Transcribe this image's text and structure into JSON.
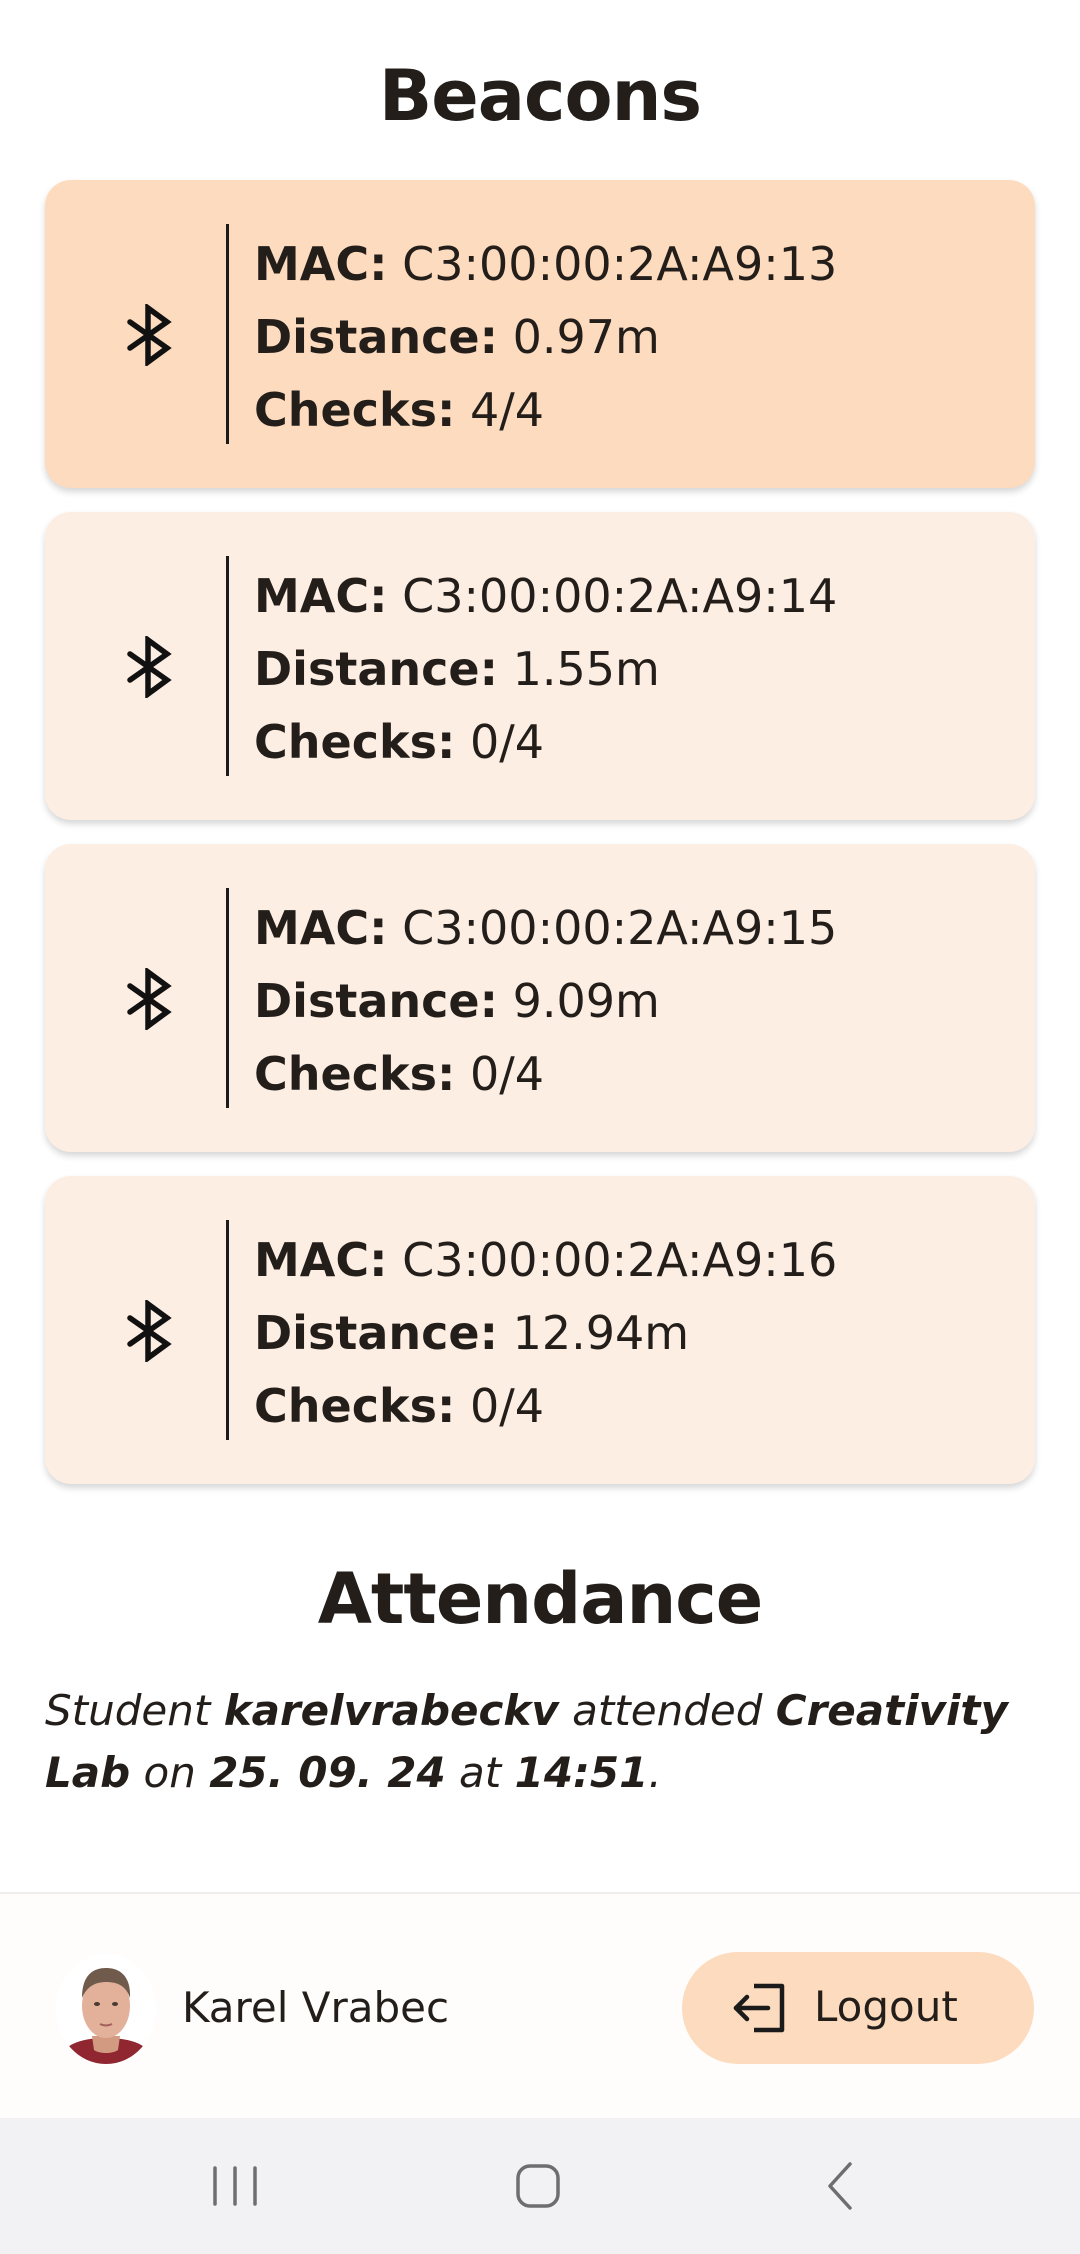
{
  "header": {
    "title": "Beacons"
  },
  "beacons": [
    {
      "mac_label": "MAC:",
      "mac": "C3:00:00:2A:A9:13",
      "distance_label": "Distance:",
      "distance": "0.97m",
      "checks_label": "Checks:",
      "checks": "4/4",
      "icon": "bluetooth-icon",
      "highlighted": true
    },
    {
      "mac_label": "MAC:",
      "mac": "C3:00:00:2A:A9:14",
      "distance_label": "Distance:",
      "distance": "1.55m",
      "checks_label": "Checks:",
      "checks": "0/4",
      "icon": "bluetooth-icon",
      "highlighted": false
    },
    {
      "mac_label": "MAC:",
      "mac": "C3:00:00:2A:A9:15",
      "distance_label": "Distance:",
      "distance": "9.09m",
      "checks_label": "Checks:",
      "checks": "0/4",
      "icon": "bluetooth-icon",
      "highlighted": false
    },
    {
      "mac_label": "MAC:",
      "mac": "C3:00:00:2A:A9:16",
      "distance_label": "Distance:",
      "distance": "12.94m",
      "checks_label": "Checks:",
      "checks": "0/4",
      "icon": "bluetooth-icon",
      "highlighted": false
    }
  ],
  "attendance": {
    "title": "Attendance",
    "t1": "Student ",
    "student": "karelvrabeckv",
    "t2": " attended ",
    "course": "Creativity Lab",
    "t3": " on ",
    "date": "25. 09. 24",
    "t4": " at ",
    "time": "14:51",
    "t5": "."
  },
  "footer": {
    "user_name": "Karel Vrabec",
    "avatar_icon": "user-avatar",
    "logout_label": "Logout",
    "logout_icon": "logout-icon"
  },
  "navbar": {
    "recent_icon": "recent-apps-icon",
    "home_icon": "home-icon",
    "back_icon": "back-icon"
  },
  "colors": {
    "card_active": "#fddbbe",
    "card_inactive": "#fdeee4",
    "accent": "#fddbbe",
    "text": "#231e1a",
    "navbar": "#f2f2f4"
  }
}
